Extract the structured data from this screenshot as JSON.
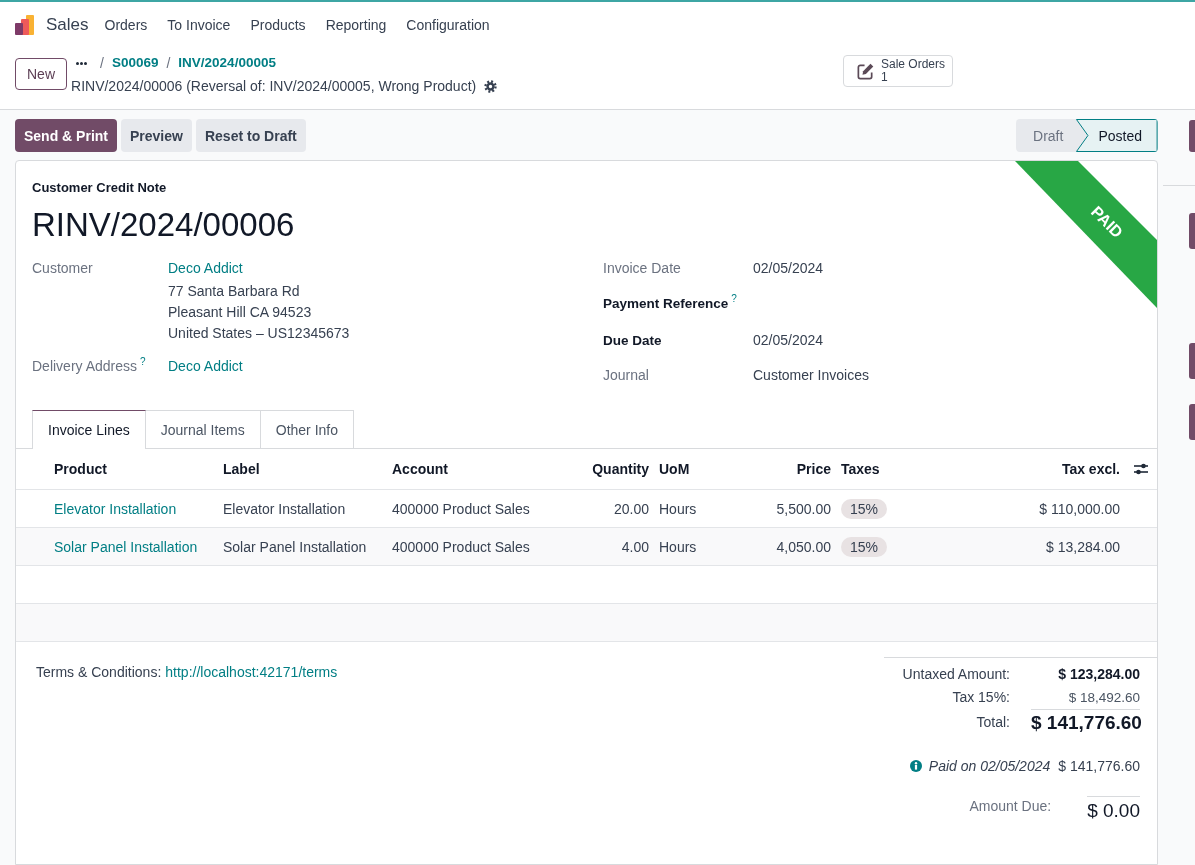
{
  "navbar": {
    "app_name": "Sales",
    "menu": [
      "Orders",
      "To Invoice",
      "Products",
      "Reporting",
      "Configuration"
    ]
  },
  "control_panel": {
    "new_button": "New",
    "breadcrumb_separator": "/",
    "breadcrumbs": [
      "S00069",
      "INV/2024/00005"
    ],
    "record_title": "RINV/2024/00006 (Reversal of: INV/2024/00005, Wrong Product)",
    "smart_button": {
      "label": "Sale Orders",
      "count": "1"
    }
  },
  "actions": [
    {
      "label": "Send & Print",
      "kind": "primary"
    },
    {
      "label": "Preview",
      "kind": "secondary"
    },
    {
      "label": "Reset to Draft",
      "kind": "secondary"
    }
  ],
  "statusbar": [
    {
      "label": "Draft",
      "selected": false
    },
    {
      "label": "Posted",
      "selected": true
    }
  ],
  "sheet": {
    "ribbon": "PAID",
    "document_type": "Customer Credit Note",
    "name": "RINV/2024/00006",
    "left_fields": [
      {
        "label": "Customer",
        "editable": false,
        "link": true,
        "value": "Deco Addict",
        "address": [
          "77 Santa Barbara Rd",
          "Pleasant Hill CA 94523",
          "United States – US12345673"
        ]
      },
      {
        "label": "Delivery Address",
        "help": "?",
        "editable": false,
        "link": true,
        "value": "Deco Addict"
      }
    ],
    "right_fields": [
      {
        "label": "Invoice Date",
        "editable": false,
        "link": false,
        "value": "02/05/2024"
      },
      {
        "label": "Payment Reference",
        "help": "?",
        "editable": true
      },
      {
        "label": "Due Date",
        "editable": true,
        "link": false,
        "value": "02/05/2024"
      },
      {
        "label": "Journal",
        "editable": false,
        "link": false,
        "value": "Customer Invoices"
      }
    ],
    "tabs": [
      {
        "label": "Invoice Lines",
        "selected": true
      },
      {
        "label": "Journal Items",
        "selected": false
      },
      {
        "label": "Other Info",
        "selected": false
      }
    ],
    "table": {
      "columns": [
        {
          "label": "Product",
          "kind": "link"
        },
        {
          "label": "Label",
          "kind": "text"
        },
        {
          "label": "Account",
          "kind": "text"
        },
        {
          "label": "Quantity",
          "kind": "number"
        },
        {
          "label": "UoM",
          "kind": "text"
        },
        {
          "label": "Price",
          "kind": "number"
        },
        {
          "label": "Taxes",
          "kind": "tags"
        },
        {
          "label": "Tax excl.",
          "kind": "number"
        }
      ],
      "rows": [
        {
          "cells": [
            "Elevator Installation",
            "Elevator Installation",
            "400000 Product Sales",
            "20.00",
            "Hours",
            "5,500.00",
            [
              "15%"
            ],
            "$ 110,000.00"
          ]
        },
        {
          "cells": [
            "Solar Panel Installation",
            "Solar Panel Installation",
            "400000 Product Sales",
            "4.00",
            "Hours",
            "4,050.00",
            [
              "15%"
            ],
            "$ 13,284.00"
          ]
        }
      ]
    },
    "terms": {
      "label": "Terms & Conditions:",
      "link": "http://localhost:42171/terms"
    },
    "totals": {
      "lines": [
        {
          "kind": "subtotal",
          "label": "Untaxed Amount:",
          "value": "$ 123,284.00"
        },
        {
          "kind": "tax",
          "label": "Tax 15%:",
          "value": "$ 18,492.60"
        },
        {
          "kind": "total",
          "label": "Total:",
          "value": "$ 141,776.60"
        }
      ],
      "payments": [
        {
          "label": "Paid on 02/05/2024",
          "amount": "$ 141,776.60"
        }
      ],
      "amount_due": {
        "label": "Amount Due:",
        "value": "$ 0.00"
      }
    }
  }
}
